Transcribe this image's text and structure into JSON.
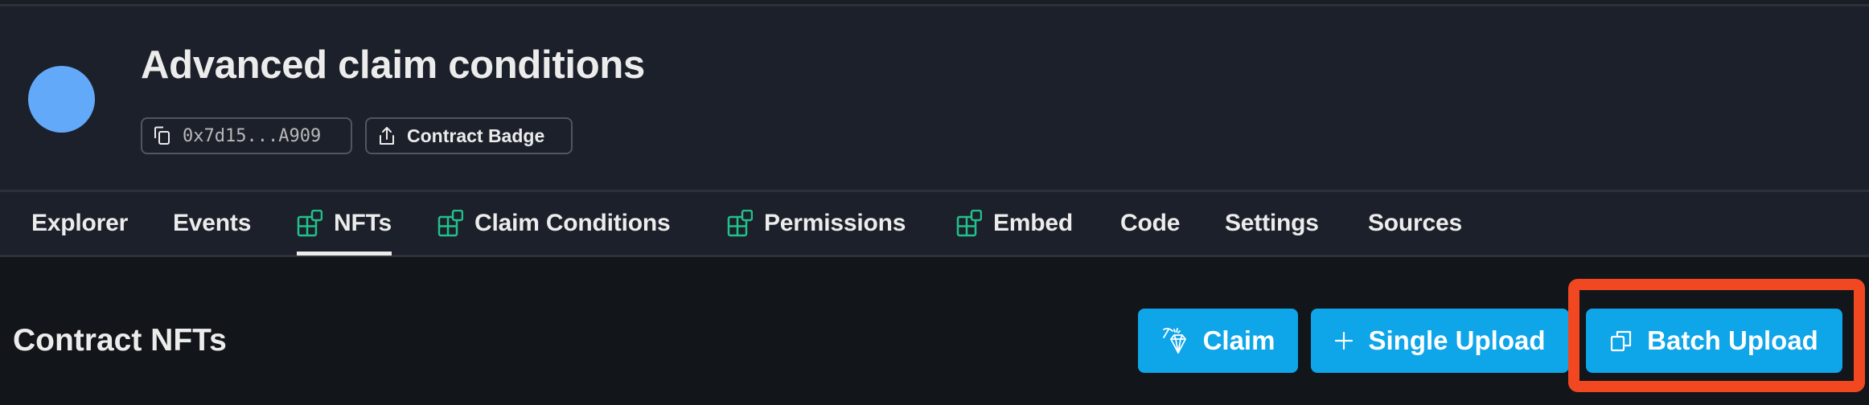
{
  "header": {
    "avatar_color": "#63a9fa",
    "title": "Advanced claim conditions",
    "address": "0x7d15...A909",
    "badge_label": "Contract Badge"
  },
  "tabs": [
    {
      "label": "Explorer",
      "icon": null,
      "active": false
    },
    {
      "label": "Events",
      "icon": null,
      "active": false
    },
    {
      "label": "NFTs",
      "icon": "extension-blocks-icon",
      "active": true
    },
    {
      "label": "Claim Conditions",
      "icon": "extension-blocks-icon",
      "active": false
    },
    {
      "label": "Permissions",
      "icon": "extension-blocks-icon",
      "active": false
    },
    {
      "label": "Embed",
      "icon": "extension-blocks-icon",
      "active": false
    },
    {
      "label": "Code",
      "icon": null,
      "active": false
    },
    {
      "label": "Settings",
      "icon": null,
      "active": false
    },
    {
      "label": "Sources",
      "icon": null,
      "active": false
    }
  ],
  "main": {
    "section_title": "Contract NFTs",
    "buttons": {
      "claim": "Claim",
      "single_upload": "Single Upload",
      "batch_upload": "Batch Upload"
    },
    "highlighted": "batch_upload"
  },
  "colors": {
    "accent_button": "#0ea5e9",
    "tab_icon": "#22c08a",
    "highlight_box": "#f24822",
    "header_bg": "#1c202a",
    "page_bg": "#121519"
  }
}
